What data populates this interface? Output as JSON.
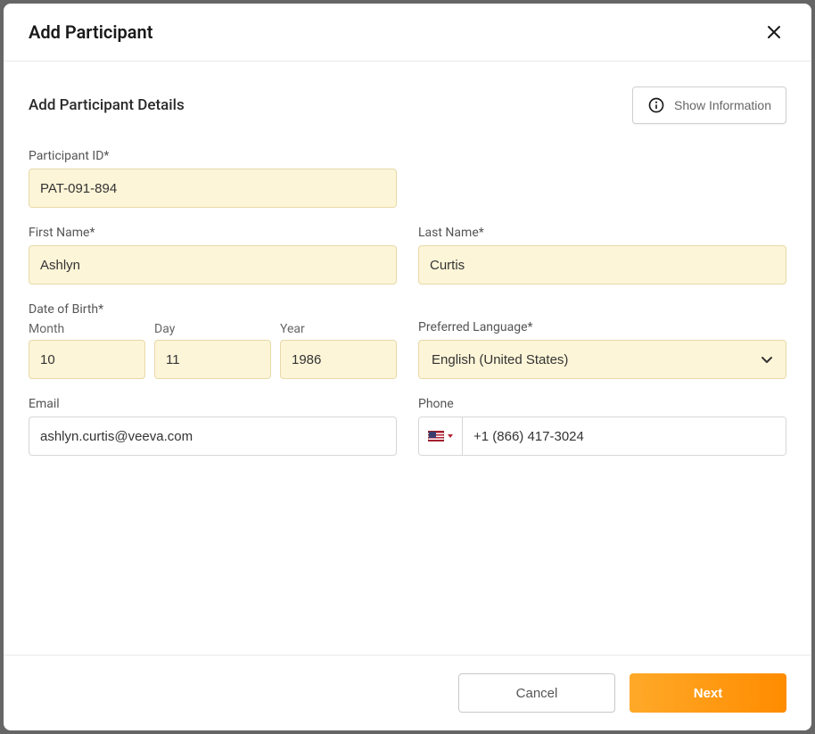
{
  "header": {
    "title": "Add Participant"
  },
  "section": {
    "title": "Add Participant Details",
    "showInfoLabel": "Show Information"
  },
  "labels": {
    "participantId": "Participant ID*",
    "firstName": "First Name*",
    "lastName": "Last Name*",
    "dob": "Date of Birth*",
    "month": "Month",
    "day": "Day",
    "year": "Year",
    "preferredLanguage": "Preferred Language*",
    "email": "Email",
    "phone": "Phone"
  },
  "values": {
    "participantId": "PAT-091-894",
    "firstName": "Ashlyn",
    "lastName": "Curtis",
    "dobMonth": "10",
    "dobDay": "11",
    "dobYear": "1986",
    "language": "English (United States)",
    "email": "ashlyn.curtis@veeva.com",
    "phone": "+1 (866) 417-3024"
  },
  "footer": {
    "cancel": "Cancel",
    "next": "Next"
  }
}
